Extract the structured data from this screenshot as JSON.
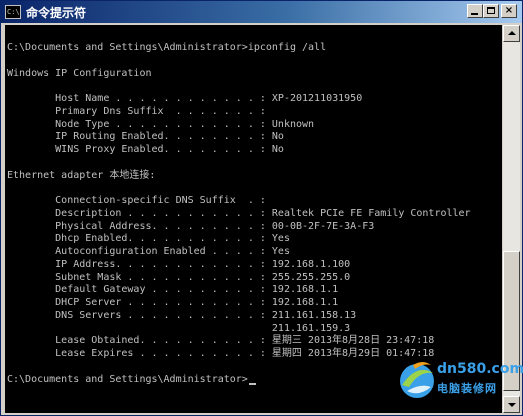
{
  "window": {
    "title": "命令提示符",
    "icon": "console-app-icon",
    "icon_glyph": "C:\\",
    "controls": {
      "minimize_icon": "minimize-icon",
      "maximize_icon": "maximize-icon",
      "close_icon": "close-icon",
      "close_glyph": "×"
    }
  },
  "console": {
    "colors": {
      "background": "#000000",
      "text": "#c0c0c0"
    },
    "lines": [
      "C:\\Documents and Settings\\Administrator>ipconfig /all",
      "",
      "Windows IP Configuration",
      "",
      "        Host Name . . . . . . . . . . . . : XP-201211031950",
      "        Primary Dns Suffix  . . . . . . . :",
      "        Node Type . . . . . . . . . . . . : Unknown",
      "        IP Routing Enabled. . . . . . . . : No",
      "        WINS Proxy Enabled. . . . . . . . : No",
      "",
      "Ethernet adapter 本地连接:",
      "",
      "        Connection-specific DNS Suffix  . :",
      "        Description . . . . . . . . . . . : Realtek PCIe FE Family Controller",
      "        Physical Address. . . . . . . . . : 00-0B-2F-7E-3A-F3",
      "        Dhcp Enabled. . . . . . . . . . . : Yes",
      "        Autoconfiguration Enabled . . . . : Yes",
      "        IP Address. . . . . . . . . . . . : 192.168.1.100",
      "        Subnet Mask . . . . . . . . . . . : 255.255.255.0",
      "        Default Gateway . . . . . . . . . : 192.168.1.1",
      "        DHCP Server . . . . . . . . . . . : 192.168.1.1",
      "        DNS Servers . . . . . . . . . . . : 211.161.158.13",
      "                                            211.161.159.3",
      "        Lease Obtained. . . . . . . . . . : 星期三 2013年8月28日 23:47:18",
      "        Lease Expires . . . . . . . . . . : 星期四 2013年8月29日 01:47:18",
      "",
      "C:\\Documents and Settings\\Administrator>"
    ]
  },
  "scrollbar": {
    "up_icon": "scroll-up-arrow-icon",
    "down_icon": "scroll-down-arrow-icon",
    "position": 0.92
  },
  "watermark": {
    "domain": "dn580.com",
    "name": "电脑装修网",
    "icon": "dn580-logo-icon"
  }
}
